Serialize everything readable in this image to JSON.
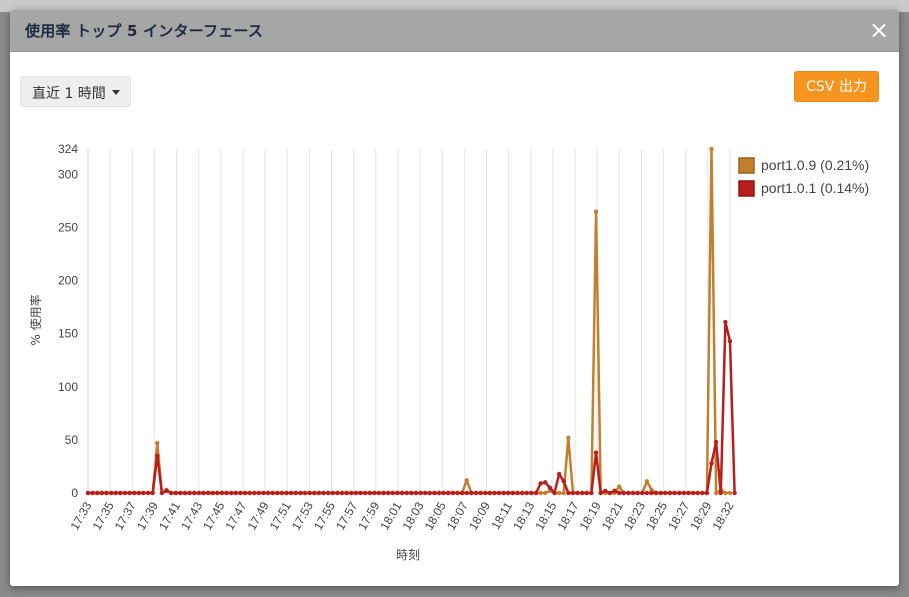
{
  "modal": {
    "title": "使用率 トップ 5 インターフェース",
    "close_label": "×"
  },
  "range_select": {
    "selected": "直近 1 時間"
  },
  "csv_button": {
    "label": "CSV 出力"
  },
  "colors": {
    "series_1": "#c47f2e",
    "series_2": "#b81e1e",
    "header_bg": "#a6a6a6",
    "csv_button_bg": "#f7941d"
  },
  "icons": {
    "close": "close-icon",
    "dropdown": "caret-down-icon"
  },
  "chart_data": {
    "type": "line",
    "xlabel": "時刻",
    "ylabel": "% 使用率",
    "ylim": [
      0,
      324
    ],
    "yticks": [
      0,
      50,
      100,
      150,
      200,
      250,
      300,
      324
    ],
    "grid": "vertical",
    "legend_position": "right",
    "x_tick_labels": [
      "17:33",
      "17:35",
      "17:37",
      "17:39",
      "17:41",
      "17:43",
      "17:45",
      "17:47",
      "17:49",
      "17:51",
      "17:53",
      "17:55",
      "17:57",
      "17:59",
      "18:01",
      "18:03",
      "18:05",
      "18:07",
      "18:09",
      "18:11",
      "18:13",
      "18:15",
      "18:17",
      "18:19",
      "18:21",
      "18:23",
      "18:25",
      "18:27",
      "18:29",
      "18:32"
    ],
    "x_start": "17:33",
    "x_end": "18:32",
    "series": [
      {
        "name": "port1.0.9 (0.21%)",
        "values": [
          0,
          0,
          0,
          0,
          0,
          0,
          0,
          0,
          0,
          0,
          0,
          0,
          0,
          0,
          0,
          47,
          0,
          3,
          0,
          0,
          0,
          0,
          0,
          0,
          0,
          0,
          0,
          0,
          0,
          0,
          0,
          0,
          0,
          0,
          0,
          0,
          0,
          0,
          0,
          0,
          0,
          0,
          0,
          0,
          0,
          0,
          0,
          0,
          0,
          0,
          0,
          0,
          0,
          0,
          0,
          0,
          0,
          0,
          0,
          0,
          0,
          0,
          0,
          0,
          0,
          0,
          0,
          0,
          0,
          0,
          0,
          0,
          0,
          0,
          0,
          0,
          0,
          0,
          0,
          0,
          0,
          0,
          12,
          0,
          0,
          0,
          0,
          0,
          0,
          0,
          0,
          0,
          0,
          0,
          0,
          0,
          0,
          0,
          0,
          0,
          2,
          0,
          0,
          0,
          52,
          0,
          0,
          0,
          0,
          0,
          265,
          0,
          0,
          0,
          0,
          6,
          0,
          0,
          0,
          0,
          0,
          11,
          3,
          0,
          0,
          0,
          0,
          0,
          0,
          0,
          0,
          0,
          0,
          0,
          0,
          324,
          0,
          3,
          0,
          0
        ]
      },
      {
        "name": "port1.0.1 (0.14%)",
        "values": [
          0,
          0,
          0,
          0,
          0,
          0,
          0,
          0,
          0,
          0,
          0,
          0,
          0,
          0,
          0,
          35,
          0,
          2,
          0,
          0,
          0,
          0,
          0,
          0,
          0,
          0,
          0,
          0,
          0,
          0,
          0,
          0,
          0,
          0,
          0,
          0,
          0,
          0,
          0,
          0,
          0,
          0,
          0,
          0,
          0,
          0,
          0,
          0,
          0,
          0,
          0,
          0,
          0,
          0,
          0,
          0,
          0,
          0,
          0,
          0,
          0,
          0,
          0,
          0,
          0,
          0,
          0,
          0,
          0,
          0,
          0,
          0,
          0,
          0,
          0,
          0,
          0,
          0,
          0,
          0,
          0,
          0,
          0,
          0,
          0,
          0,
          0,
          0,
          0,
          0,
          0,
          0,
          0,
          0,
          0,
          0,
          0,
          0,
          9,
          10,
          5,
          0,
          18,
          11,
          0,
          0,
          0,
          0,
          0,
          0,
          38,
          0,
          2,
          0,
          2,
          0,
          0,
          0,
          0,
          0,
          0,
          0,
          0,
          0,
          0,
          0,
          0,
          0,
          0,
          0,
          0,
          0,
          0,
          0,
          0,
          28,
          48,
          0,
          161,
          143,
          0
        ]
      }
    ]
  }
}
